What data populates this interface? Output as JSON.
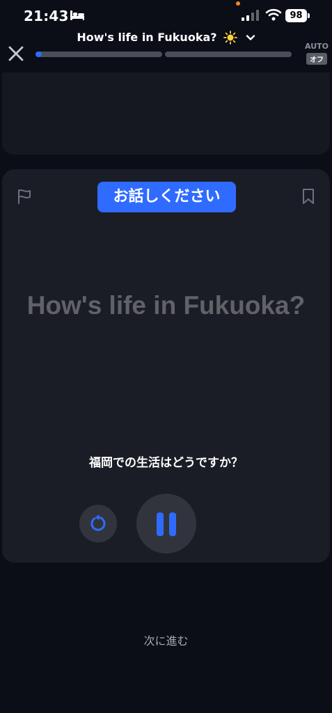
{
  "status_bar": {
    "time": "21:43",
    "battery": "98",
    "icons": [
      "bed-icon",
      "signal-icon",
      "wifi-icon",
      "battery-icon"
    ],
    "indicator_color": "#f08a2c"
  },
  "header": {
    "lesson_title": "How's life in Fukuoka?",
    "title_icon": "sun-icon",
    "close_icon": "close-icon",
    "progress": [
      0.05,
      0
    ],
    "auto_label": "AUTO",
    "auto_state": "オフ"
  },
  "card": {
    "prompt": "お話しください",
    "english": "How's life in Fukuoka?",
    "japanese": "福岡での生活はどうですか？",
    "flag_icon": "flag-icon",
    "bookmark_icon": "bookmark-icon",
    "replay_icon": "replay-icon",
    "pause_icon": "pause-icon"
  },
  "footer": {
    "next_label": "次に進む"
  },
  "colors": {
    "background": "#0b0d17",
    "card": "#1b1d26",
    "accent": "#2f6bff",
    "english_text": "#616168"
  }
}
